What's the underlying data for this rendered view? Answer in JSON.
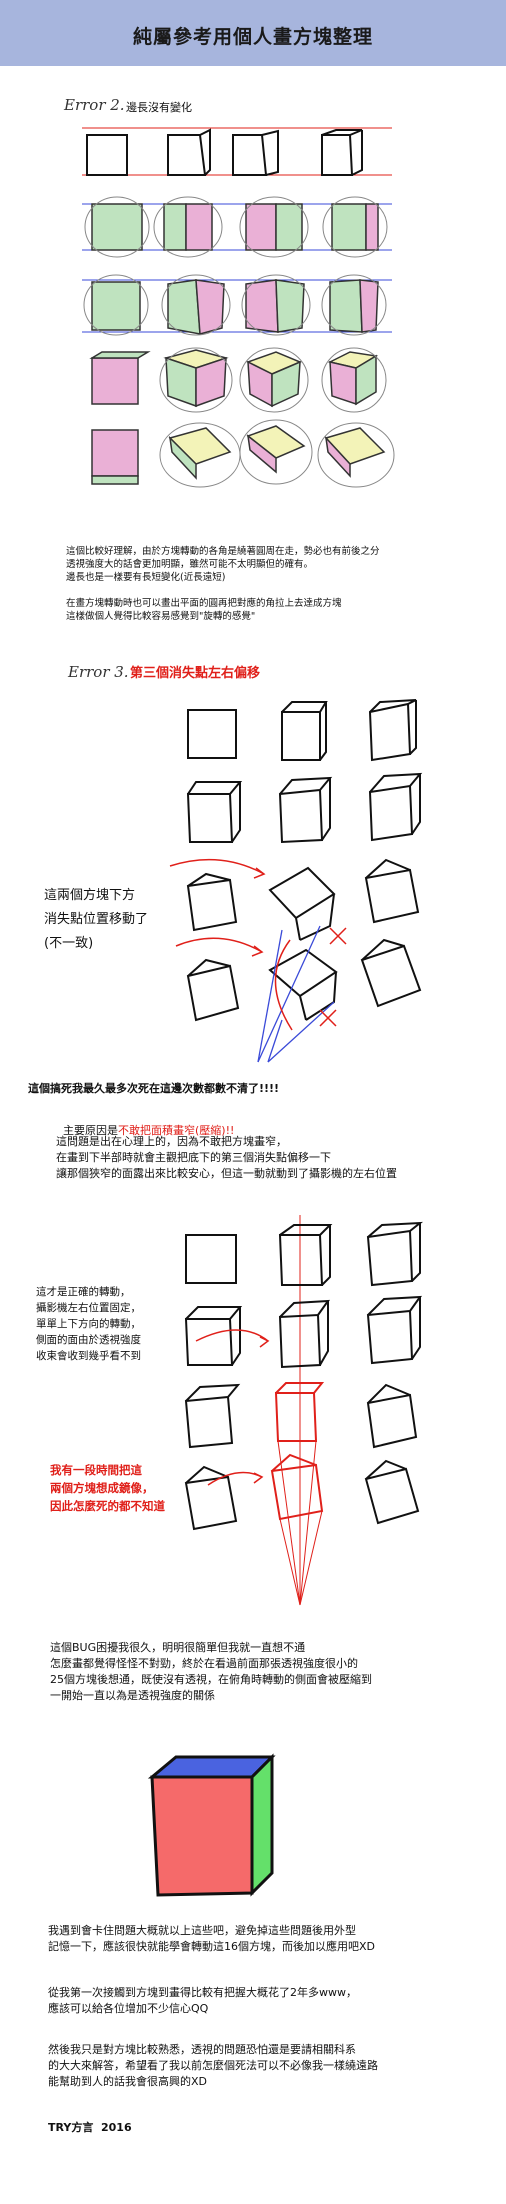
{
  "header": {
    "title": "純屬參考用個人畫方塊整理"
  },
  "section2": {
    "label": "Error 2.",
    "heading": "邊長沒有變化",
    "para1": "這個比較好理解，由於方塊轉動的各角是繞著圓周在走，勢必也有前後之分\n透視強度大的話會更加明顯，雖然可能不太明顯但的確有。\n邊長也是一樣要有長短變化(近長遠短)",
    "para2": "在畫方塊轉動時也可以畫出平面的圓再把對應的角拉上去達成方塊\n這樣做個人覺得比較容易感覺到\"旋轉的感覺\""
  },
  "section3": {
    "label": "Error 3.",
    "heading": "第三個消失點左右偏移",
    "side_note": "這兩個方塊下方\n消失點位置移動了\n(不一致)",
    "bold_line": "這個搞死我最久最多次死在這邊次數都數不清了!!!!",
    "reason_prefix": "主要原因是",
    "reason_red": "不敢把面積畫窄(壓縮)!!",
    "para": "這問題是出在心理上的，因為不敢把方塊畫窄，\n在畫到下半部時就會主觀把底下的第三個消失點偏移一下\n讓那個狹窄的面露出來比較安心，但這一動就動到了攝影機的左右位置",
    "correct_note": "這才是正確的轉動，\n攝影機左右位置固定，\n單單上下方向的轉動，\n側面的面由於透視強度\n收束會收到幾乎看不到",
    "mirror_note": "我有一段時間把這\n兩個方塊想成鏡像，\n因此怎麼死的都不知道",
    "bug_para": "這個BUG困擾我很久，明明很簡單但我就一直想不通\n怎麼畫都覺得怪怪不對勁，終於在看過前面那張透視強度很小的\n25個方塊後想通，既使沒有透視，在俯角時轉動的側面會被壓縮到\n一開始一直以為是透視強度的關係"
  },
  "closing": {
    "para1": "我遇到會卡住問題大概就以上這些吧，避免掉這些問題後用外型\n記憶一下，應該很快就能學會轉動這16個方塊，而後加以應用吧XD",
    "para2": "從我第一次接觸到方塊到畫得比較有把握大概花了2年多www，\n應該可以給各位增加不少信心QQ",
    "para3": "然後我只是對方塊比較熟悉，透視的問題恐怕還是要請相關科系\n的大大來解答，希望看了我以前怎麼個死法可以不必像我一樣繞遠路\n能幫助到人的話我會很高興的XD",
    "signature": "TRY方言  2016"
  },
  "colors": {
    "header": "#a7b5dd",
    "accent_red": "#e0201a",
    "guide_blue": "#3a4ad8",
    "fill_pink": "#eab0d6",
    "fill_green": "#bfe3bf",
    "fill_yellow": "#f3f3b8"
  }
}
